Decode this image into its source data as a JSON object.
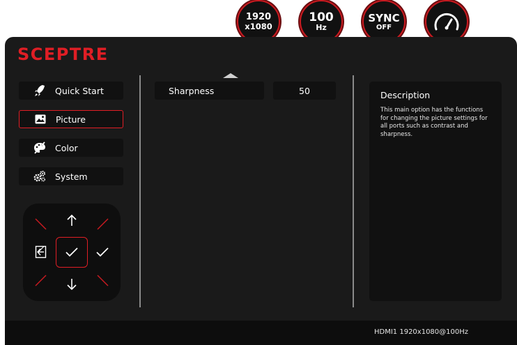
{
  "brand": {
    "logo_text": "SCEPTRE",
    "accent_color": "#e01e25"
  },
  "badges": [
    {
      "line1": "1920",
      "line2": "x1080"
    },
    {
      "line1": "100",
      "line2": "Hz"
    },
    {
      "line1": "SYNC",
      "line2": "OFF"
    },
    {
      "icon": "speedometer-icon"
    }
  ],
  "menu": {
    "items": [
      {
        "label": "Quick Start",
        "icon": "rocket-icon",
        "selected": false
      },
      {
        "label": "Picture",
        "icon": "picture-icon",
        "selected": true
      },
      {
        "label": "Color",
        "icon": "palette-icon",
        "selected": false
      },
      {
        "label": "System",
        "icon": "gears-icon",
        "selected": false
      }
    ]
  },
  "settings": {
    "rows": [
      {
        "label": "Sharpness",
        "value": "50"
      }
    ]
  },
  "description": {
    "title": "Description",
    "text": "This main option has the functions for changing the picture settings for all ports such as contrast and sharpness."
  },
  "nav_pad": {
    "icons": [
      "arrow-up-icon",
      "arrow-down-icon",
      "exit-icon",
      "check-icon",
      "confirm-check-icon"
    ]
  },
  "status": {
    "text": "HDMI1 1920x1080@100Hz"
  }
}
